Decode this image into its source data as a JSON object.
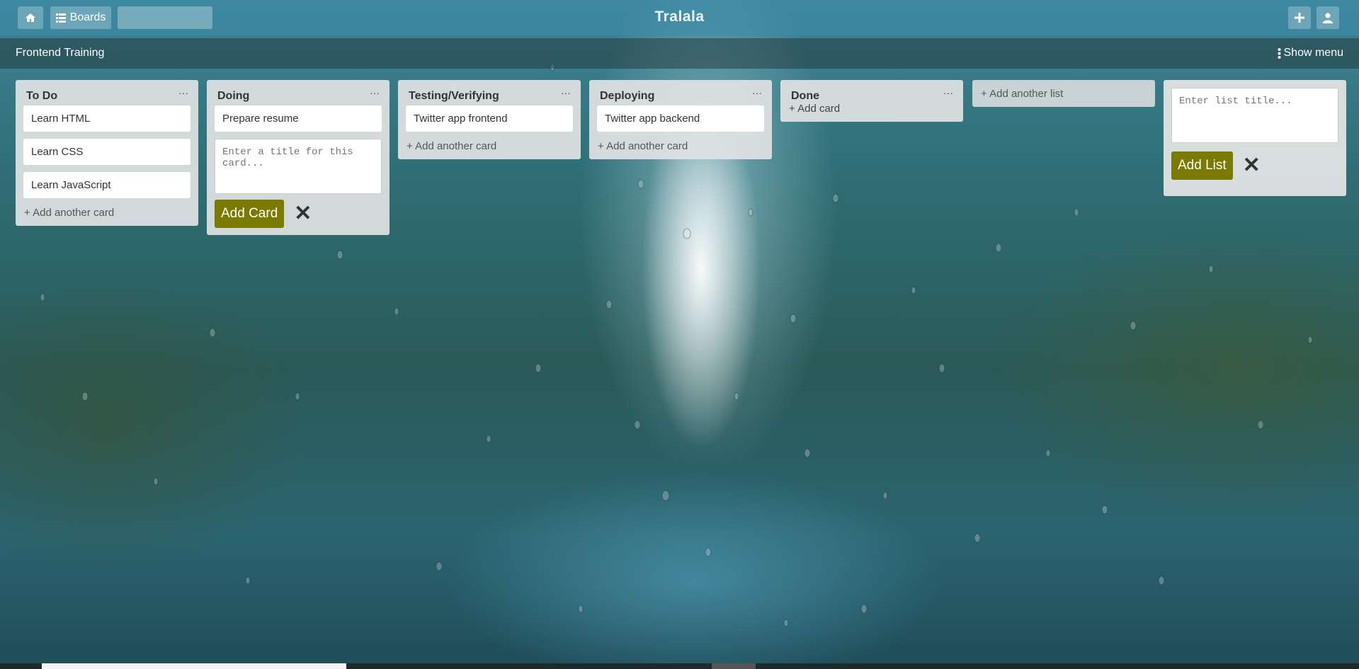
{
  "header": {
    "brand": "Tralala",
    "boards_label": "Boards",
    "search_placeholder": ""
  },
  "board": {
    "title": "Frontend Training",
    "show_menu_label": "Show menu"
  },
  "lists": [
    {
      "title": "To Do",
      "cards": [
        "Learn HTML",
        "Learn CSS",
        "Learn JavaScript"
      ],
      "add_label": "+ Add another card"
    },
    {
      "title": "Doing",
      "cards": [
        "Prepare resume"
      ],
      "composer_placeholder": "Enter a title for this card...",
      "add_button": "Add Card"
    },
    {
      "title": "Testing/Verifying",
      "cards": [
        "Twitter app frontend"
      ],
      "add_label": "+ Add another card"
    },
    {
      "title": "Deploying",
      "cards": [
        "Twitter app backend"
      ],
      "add_label": "+ Add another card"
    },
    {
      "title": "Done",
      "cards": [],
      "add_label": "+ Add card"
    }
  ],
  "add_list_label": "+ Add another list",
  "new_list": {
    "placeholder": "Enter list title...",
    "button": "Add List"
  },
  "menu_dots": "···",
  "colors": {
    "olive_button": "#7a7a00",
    "topbar": "rgba(60,140,170,0.55)"
  },
  "icons": [
    "home-icon",
    "boards-icon",
    "plus-icon",
    "user-icon",
    "vertical-dots-icon",
    "close-icon"
  ]
}
